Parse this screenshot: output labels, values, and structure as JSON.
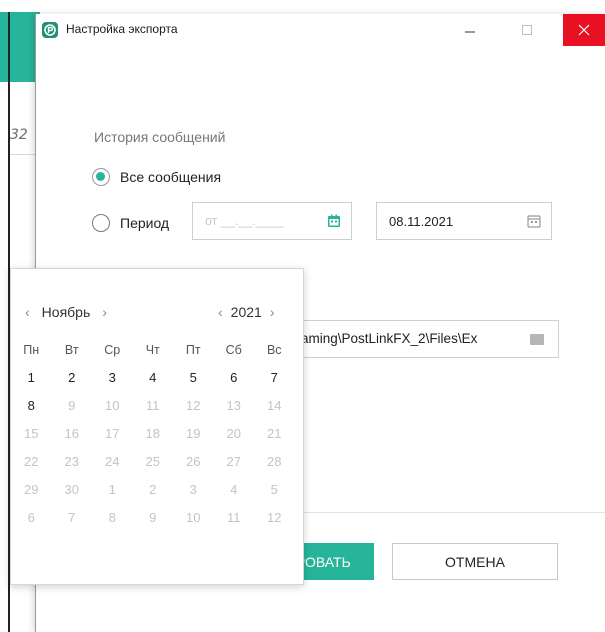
{
  "background": {
    "partial_number": "32"
  },
  "window": {
    "title": "Настройка экспорта",
    "accent": "#26b59a",
    "close_color": "#e81123"
  },
  "history": {
    "label": "История сообщений",
    "option_all": "Все сообщения",
    "option_period": "Период",
    "selected": "Все сообщения",
    "from_placeholder": "от __.__.____",
    "to_value": "08.11.2021"
  },
  "export_path": {
    "value": "aming\\PostLinkFX_2\\Files\\Ex"
  },
  "buttons": {
    "export_label": "РОВАТЬ",
    "cancel_label": "ОТМЕНА"
  },
  "calendar": {
    "month": "Ноябрь",
    "year": "2021",
    "weekdays": [
      "Пн",
      "Вт",
      "Ср",
      "Чт",
      "Пт",
      "Сб",
      "Вс"
    ],
    "weeks": [
      [
        "1",
        "2",
        "3",
        "4",
        "5",
        "6",
        "7"
      ],
      [
        "8",
        "9",
        "10",
        "11",
        "12",
        "13",
        "14"
      ],
      [
        "15",
        "16",
        "17",
        "18",
        "19",
        "20",
        "21"
      ],
      [
        "22",
        "23",
        "24",
        "25",
        "26",
        "27",
        "28"
      ],
      [
        "29",
        "30",
        "1",
        "2",
        "3",
        "4",
        "5"
      ],
      [
        "6",
        "7",
        "8",
        "9",
        "10",
        "11",
        "12"
      ]
    ],
    "enabled_days": [
      "1",
      "2",
      "3",
      "4",
      "5",
      "6",
      "7",
      "8"
    ]
  }
}
